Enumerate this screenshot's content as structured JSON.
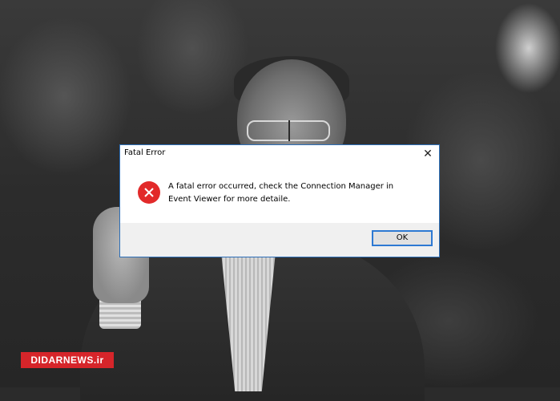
{
  "dialog": {
    "title": "Fatal Error",
    "close_glyph": "✕",
    "message_line1": "A fatal error occurred, check the Connection Manager in",
    "message_line2": "Event Viewer for more detaile.",
    "ok_label": "OK",
    "icon": "error-x-icon"
  },
  "watermark": {
    "text": "DIDARNEWS.ir"
  },
  "colors": {
    "error_red": "#e22a2a",
    "accent_blue": "#2d79d3",
    "watermark_red": "#d6252a"
  }
}
